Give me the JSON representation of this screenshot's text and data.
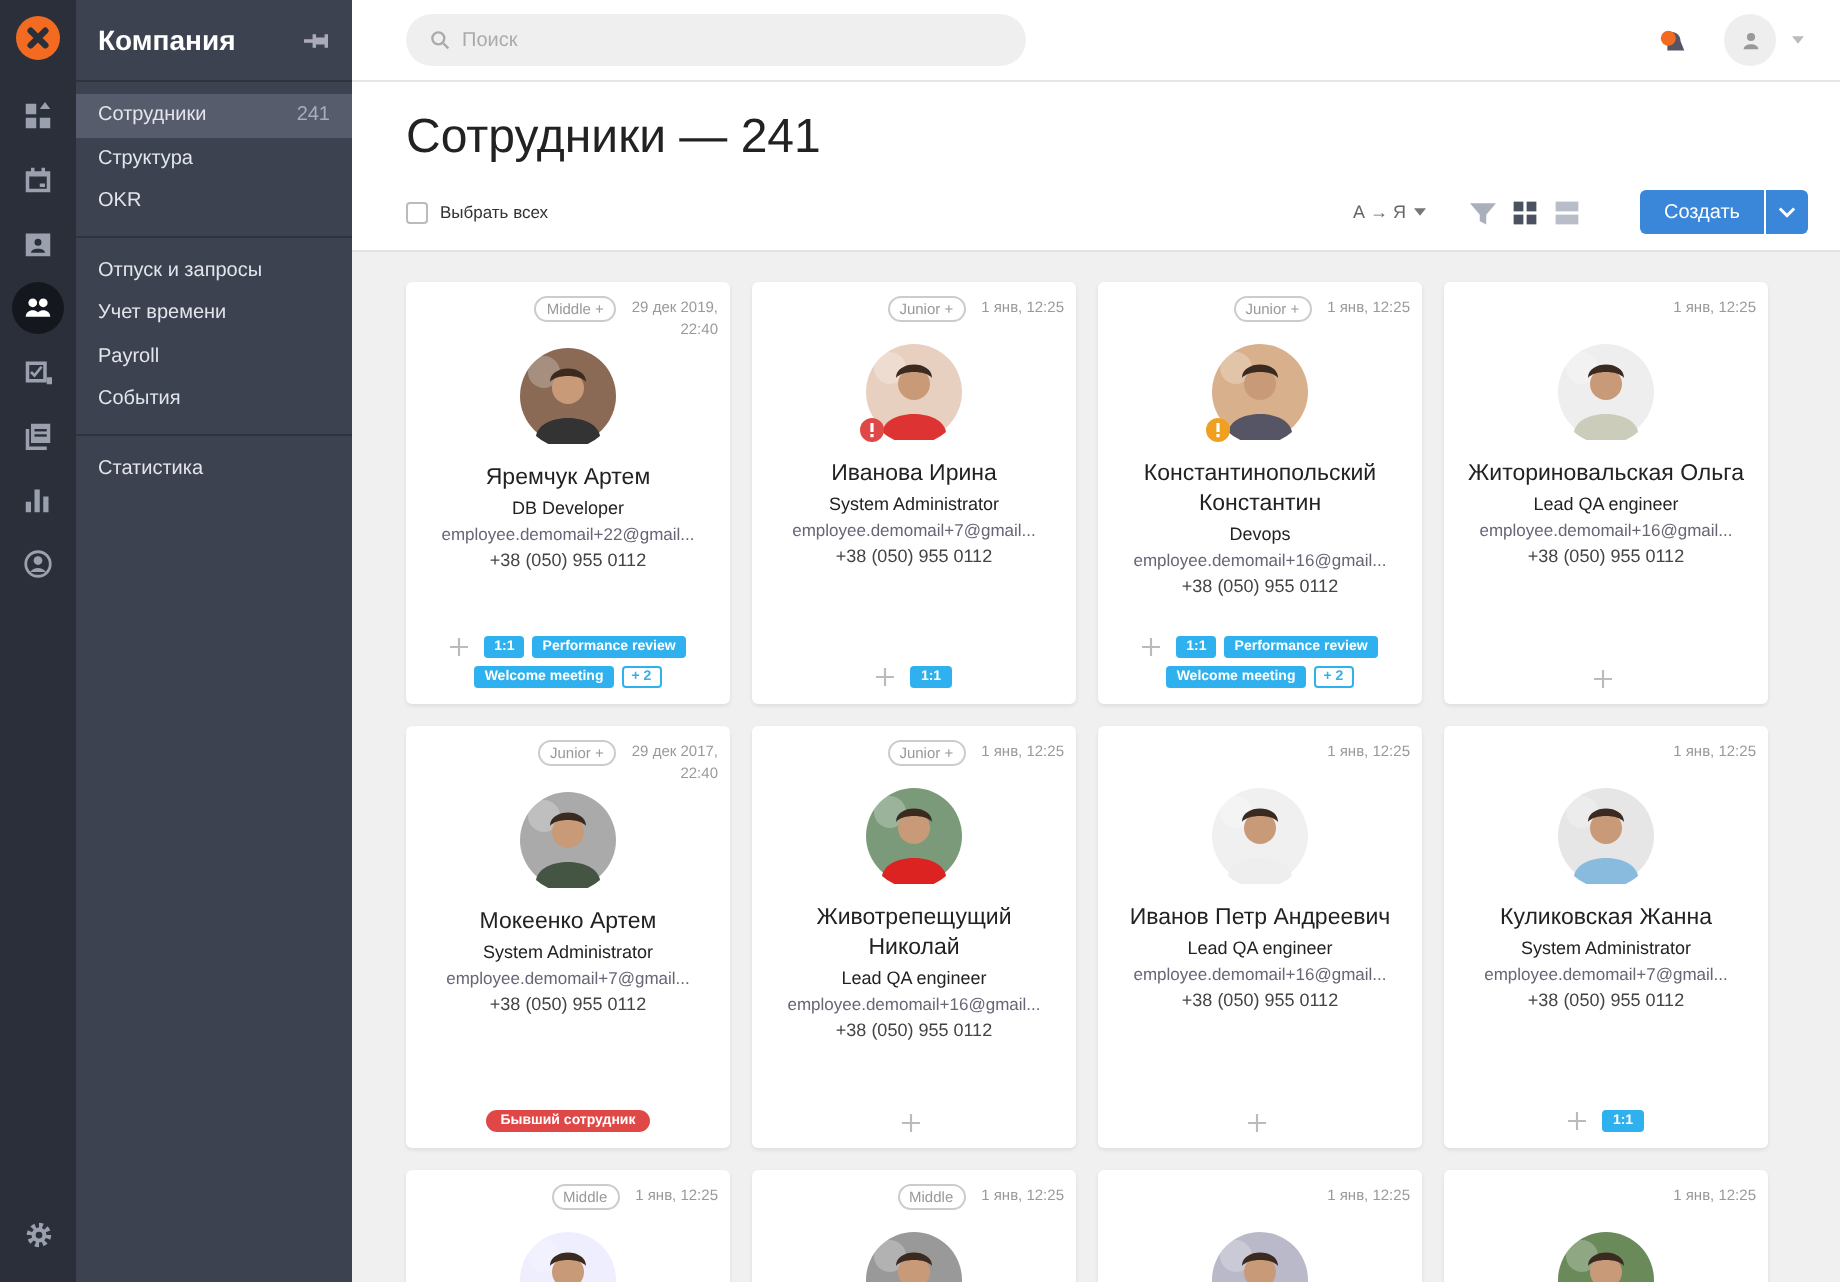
{
  "rail": {
    "items": [
      {
        "kind": "dashboard",
        "selected": false
      },
      {
        "kind": "calendar",
        "selected": false
      },
      {
        "kind": "contact",
        "selected": false
      },
      {
        "kind": "people",
        "selected": true
      },
      {
        "kind": "tasks",
        "selected": false
      },
      {
        "kind": "docs",
        "selected": false
      },
      {
        "kind": "chart",
        "selected": false
      },
      {
        "kind": "account",
        "selected": false
      }
    ]
  },
  "sidebar": {
    "title": "Компания",
    "groups": [
      [
        {
          "label": "Сотрудники",
          "count": "241",
          "selected": true
        },
        {
          "label": "Структура",
          "selected": false
        },
        {
          "label": "OKR",
          "selected": false
        }
      ],
      [
        {
          "label": "Отпуск и запросы",
          "selected": false
        },
        {
          "label": "Учет времени",
          "selected": false
        },
        {
          "label": "Payroll",
          "selected": false
        },
        {
          "label": "События",
          "selected": false
        }
      ],
      [
        {
          "label": "Статистика",
          "selected": false
        }
      ]
    ]
  },
  "search": {
    "placeholder": "Поиск"
  },
  "page": {
    "title": "Сотрудники — 241",
    "select_all": {
      "label": "Выбрать всех",
      "checked": false
    },
    "sort": "А → Я",
    "views": [
      {
        "kind": "grid",
        "selected": true
      },
      {
        "kind": "list",
        "selected": false
      }
    ],
    "create_button": "Создать"
  },
  "cards": [
    {
      "level": "Middle +",
      "date": [
        "29 дек 2019,",
        "22:40"
      ],
      "name": "Яремчук Артем",
      "role": "DB Developer",
      "email": "employee.demomail+22@gmail...",
      "phone": "+38 (050) 955 0112",
      "add": true,
      "tags": [
        {
          "kind": "event",
          "label": "1:1"
        },
        {
          "kind": "event",
          "label": "Performance review"
        },
        {
          "kind": "event",
          "label": "Welcome meeting"
        },
        {
          "kind": "more",
          "label": "+ 2"
        }
      ]
    },
    {
      "level": "Junior +",
      "date": [
        "1 янв, 12:25"
      ],
      "alert": {
        "color": "#e04848"
      },
      "name": "Иванова Ирина",
      "role": "System Administrator",
      "email": "employee.demomail+7@gmail...",
      "phone": "+38 (050) 955 0112",
      "add": true,
      "tags": [
        {
          "kind": "event",
          "label": "1:1"
        }
      ]
    },
    {
      "level": "Junior +",
      "date": [
        "1 янв, 12:25"
      ],
      "alert": {
        "color": "#f0a020"
      },
      "name": "Константинопольский Константин",
      "role": "Devops",
      "email": "employee.demomail+16@gmail...",
      "phone": "+38 (050) 955 0112",
      "add": true,
      "tags": [
        {
          "kind": "event",
          "label": "1:1"
        },
        {
          "kind": "event",
          "label": "Performance review"
        },
        {
          "kind": "event",
          "label": "Welcome meeting"
        },
        {
          "kind": "more",
          "label": "+ 2"
        }
      ]
    },
    {
      "date": [
        "1 янв, 12:25"
      ],
      "name": "Житориновальская Ольга",
      "role": "Lead QA engineer",
      "email": "employee.demomail+16@gmail...",
      "phone": "+38 (050) 955 0112",
      "add": true
    },
    {
      "level": "Junior +",
      "date": [
        "29 дек 2017,",
        "22:40"
      ],
      "name": "Мокеенко Артем",
      "role": "System Administrator",
      "email": "employee.demomail+7@gmail...",
      "phone": "+38 (050) 955 0112",
      "add": false,
      "tags": [
        {
          "kind": "former",
          "label": "Бывший сотрудник"
        }
      ]
    },
    {
      "level": "Junior +",
      "date": [
        "1 янв, 12:25"
      ],
      "name": "Животрепещущий Николай",
      "role": "Lead QA engineer",
      "email": "employee.demomail+16@gmail...",
      "phone": "+38 (050) 955 0112",
      "add": true
    },
    {
      "date": [
        "1 янв, 12:25"
      ],
      "name": "Иванов Петр Андреевич",
      "role": "Lead QA engineer",
      "email": "employee.demomail+16@gmail...",
      "phone": "+38 (050) 955 0112",
      "add": true
    },
    {
      "date": [
        "1 янв, 12:25"
      ],
      "name": "Куликовская Жанна",
      "role": "System Administrator",
      "email": "employee.demomail+7@gmail...",
      "phone": "+38 (050) 955 0112",
      "add": true,
      "tags": [
        {
          "kind": "event",
          "label": "1:1"
        }
      ]
    },
    {
      "level": "Middle",
      "date": [
        "1 янв, 12:25"
      ]
    },
    {
      "level": "Middle",
      "date": [
        "1 янв, 12:25"
      ]
    },
    {
      "date": [
        "1 янв, 12:25"
      ]
    },
    {
      "date": [
        "1 янв, 12:25"
      ]
    }
  ]
}
